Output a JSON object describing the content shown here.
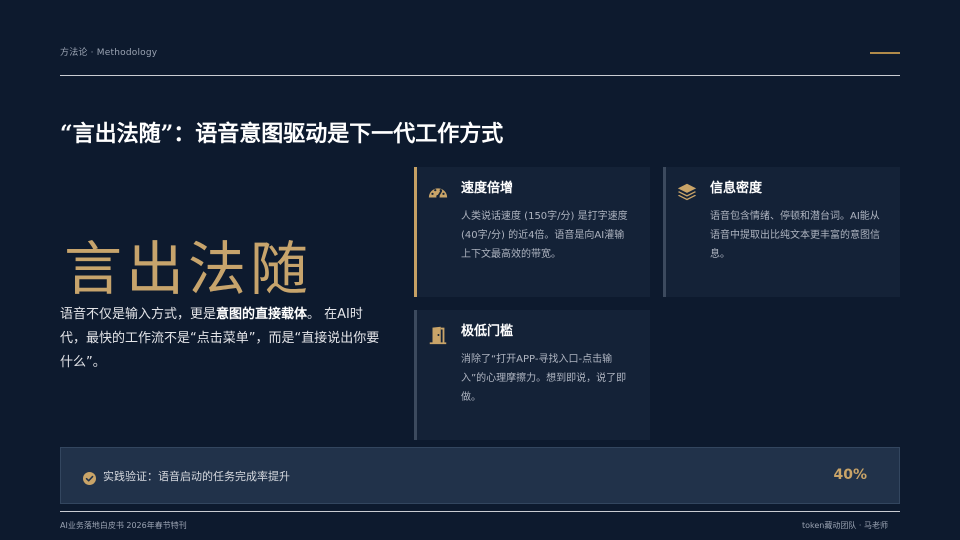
{
  "header": {
    "section_label": "方法论 · Methodology"
  },
  "title": "“言出法随”：语音意图驱动是下一代工作方式",
  "big_heading": "言出法随",
  "description": {
    "part1": "语音不仅是输入方式，更是",
    "bold": "意图的直接载体",
    "part2": "。 在AI时代，最快的工作流不是“点击菜单”，而是“直接说出你要什么”。"
  },
  "cards": [
    {
      "title": "速度倍增",
      "icon": "speedometer-icon",
      "body": "人类说话速度 (150字/分) 是打字速度 (40字/分) 的近4倍。语音是向AI灌输上下文最高效的带宽。"
    },
    {
      "title": "信息密度",
      "icon": "layers-icon",
      "body": "语音包含情绪、停顿和潜台词。AI能从语音中提取出比纯文本更丰富的意图信息。"
    },
    {
      "title": "极低门槛",
      "icon": "door-open-icon",
      "body": "消除了“打开APP-寻找入口-点击输入”的心理摩擦力。想到即说，说了即做。"
    }
  ],
  "practice": {
    "label": "实践验证：语音启动的任务完成率提升",
    "value": "40%"
  },
  "footer": {
    "left": "AI业务落地白皮书 2026年春节特刊",
    "right": "token藏动团队 · 马老师"
  },
  "colors": {
    "background": "#0d1a2e",
    "accent_gold": "#c7a46c",
    "card_bg": "#142237"
  }
}
